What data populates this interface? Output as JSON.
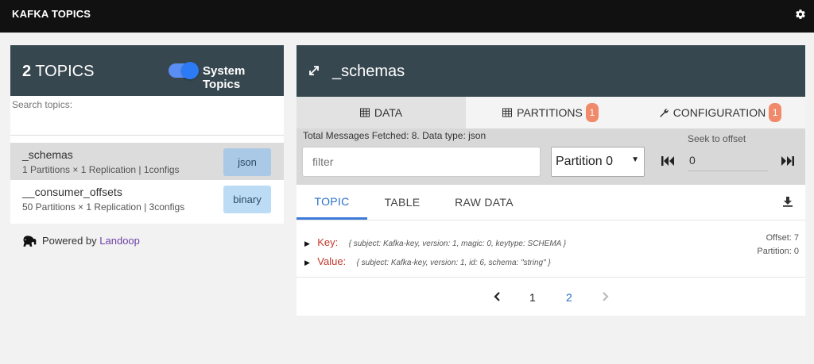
{
  "app": {
    "title": "KAFKA TOPICS",
    "settings_icon": "gear-icon"
  },
  "left": {
    "count_number": "2",
    "count_label": "TOPICS",
    "system_topics_label": "System Topics",
    "system_topics_on": true,
    "search_placeholder": "Search topics:",
    "topics": [
      {
        "name": "_schemas",
        "meta": "1 Partitions × 1 Replication | 1configs",
        "type": "json",
        "selected": true
      },
      {
        "name": "__consumer_offsets",
        "meta": "50 Partitions × 1 Replication | 3configs",
        "type": "binary",
        "selected": false
      }
    ],
    "powered_prefix": "Powered by",
    "powered_link": "Landoop"
  },
  "right": {
    "topic_title": "_schemas",
    "tabs": {
      "data": "DATA",
      "partitions": "PARTITIONS",
      "partitions_count": "1",
      "configuration": "CONFIGURATION",
      "configuration_count": "1"
    },
    "info": "Total Messages Fetched: 8. Data type: json",
    "filter_placeholder": "filter",
    "partition_value": "Partition 0",
    "seek_label": "Seek to offset",
    "seek_value": "0",
    "subtabs": {
      "topic": "TOPIC",
      "table": "TABLE",
      "raw": "RAW DATA"
    },
    "record": {
      "key_label": "Key:",
      "key_value": "{ subject: Kafka-key, version: 1, magic: 0, keytype: SCHEMA }",
      "value_label": "Value:",
      "value_value": "{ subject: Kafka-key, version: 1, id: 6, schema: \"string\" }",
      "offset": "Offset: 7",
      "partition": "Partition: 0"
    },
    "pager": {
      "page1": "1",
      "page2": "2"
    }
  },
  "colors": {
    "header": "#37474f",
    "accent": "#2a6fc9",
    "badge": "#f08a6a",
    "key_label": "#c0392b"
  }
}
